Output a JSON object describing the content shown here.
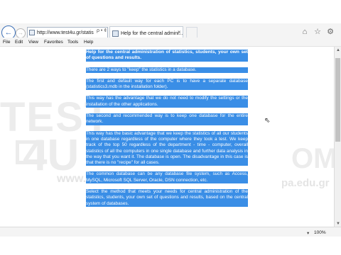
{
  "browser": {
    "address_url": "http://www.test4u.gr/statis",
    "address_tools": "ρ • ¢",
    "tab_title": "Help for the central admini...",
    "tab_close": "×"
  },
  "icons": {
    "back": "←",
    "forward": "→",
    "home": "⌂",
    "favorites": "☆",
    "settings": "⚙",
    "zoom": "▾",
    "cursor": "⇖",
    "scroll_up": "▲",
    "scroll_down": "▼"
  },
  "menu": {
    "file": "File",
    "edit": "Edit",
    "view": "View",
    "favorites": "Favorites",
    "tools": "Tools",
    "help": "Help"
  },
  "watermark": {
    "line1": "TEST",
    "line2": "4U",
    "line3": "OMA",
    "url_left": "www.test",
    "url_right": "pa.edu.gr"
  },
  "document": {
    "title": "Help for the central administration of statistics, students, your own set of questions and results.",
    "p1": "There are 2 ways to \"keep\" the statistics in a database.",
    "p2": "The first and default way for each PC is to have a separate database (statistics3.mdb in the installation folder).",
    "p3": "This way has the advantage that we do not need to modify the settings or the installation of the other applications.",
    "p4": "The second and recommended way is to keep one database for the entire network.",
    "p5": "This way has the basic advantage that we keep the statistics of all our students in one database regardless of the computer where they took a test. We keep track of the top 50 regardless of the department - time - computer, overall statistics of all the computers in one single database and further data analysis in the way that you want it. The database is open. The disadvantage in this case is that there is no \"recipe\" for all cases.",
    "p6": "The common database can be any database file system, such as Access, MySQL, Microsoft SQL Server, Oracle, DSN connection, etc.",
    "p7": "Select the method that meets your needs for central administration of the statistics, students, your own set of questions and results, based on the central system of databases."
  },
  "status": {
    "zoom": "100%"
  },
  "colors": {
    "selection": "#3a8ee6",
    "chrome": "#f4f4f4"
  }
}
